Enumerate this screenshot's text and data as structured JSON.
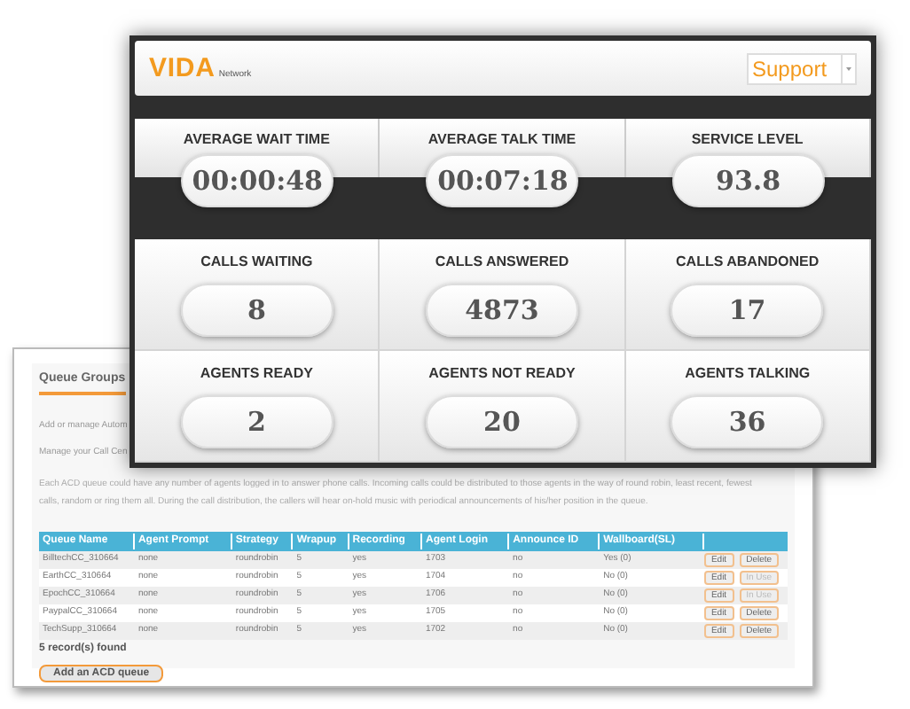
{
  "queue_page": {
    "tab": "Queue Groups",
    "lines": [
      "Add or manage Autom",
      "Manage your Call Cen"
    ],
    "description": [
      "Each ACD queue could have any number of agents logged in to answer phone calls. Incoming calls could be distributed to those agents in the way of round robin, least recent, fewest",
      "calls, random or ring them all. During the call distribution, the callers will hear on-hold music with periodical announcements of his/her position in the queue."
    ],
    "table": {
      "columns": [
        "Queue Name",
        "Agent Prompt",
        "Strategy",
        "Wrapup",
        "Recording",
        "Agent Login",
        "Announce ID",
        "Wallboard(SL)"
      ],
      "rows": [
        {
          "cells": [
            "BilltechCC_310664",
            "none",
            "roundrobin",
            "5",
            "yes",
            "1703",
            "no",
            "Yes (0)"
          ],
          "actions": [
            {
              "label": "Edit",
              "disabled": false
            },
            {
              "label": "Delete",
              "disabled": false
            }
          ]
        },
        {
          "cells": [
            "EarthCC_310664",
            "none",
            "roundrobin",
            "5",
            "yes",
            "1704",
            "no",
            "No (0)"
          ],
          "actions": [
            {
              "label": "Edit",
              "disabled": false
            },
            {
              "label": "In Use",
              "disabled": true
            }
          ]
        },
        {
          "cells": [
            "EpochCC_310664",
            "none",
            "roundrobin",
            "5",
            "yes",
            "1706",
            "no",
            "No (0)"
          ],
          "actions": [
            {
              "label": "Edit",
              "disabled": false
            },
            {
              "label": "In Use",
              "disabled": true
            }
          ]
        },
        {
          "cells": [
            "PaypalCC_310664",
            "none",
            "roundrobin",
            "5",
            "yes",
            "1705",
            "no",
            "No (0)"
          ],
          "actions": [
            {
              "label": "Edit",
              "disabled": false
            },
            {
              "label": "Delete",
              "disabled": false
            }
          ]
        },
        {
          "cells": [
            "TechSupp_310664",
            "none",
            "roundrobin",
            "5",
            "yes",
            "1702",
            "no",
            "No (0)"
          ],
          "actions": [
            {
              "label": "Edit",
              "disabled": false
            },
            {
              "label": "Delete",
              "disabled": false
            }
          ]
        }
      ]
    },
    "record_count": "5 record(s) found",
    "add_button": "Add an ACD queue"
  },
  "dashboard": {
    "logo": "VIDA",
    "logo_sub": "Network",
    "department": {
      "value": "Support"
    },
    "top_metrics": [
      {
        "label": "AVERAGE WAIT TIME",
        "value": "00:00:48"
      },
      {
        "label": "AVERAGE TALK TIME",
        "value": "00:07:18"
      },
      {
        "label": "SERVICE LEVEL",
        "value": "93.8"
      }
    ],
    "grid_metrics": [
      {
        "label": "CALLS WAITING",
        "value": "8"
      },
      {
        "label": "CALLS ANSWERED",
        "value": "4873"
      },
      {
        "label": "CALLS ABANDONED",
        "value": "17"
      },
      {
        "label": "AGENTS READY",
        "value": "2"
      },
      {
        "label": "AGENTS NOT READY",
        "value": "20"
      },
      {
        "label": "AGENTS TALKING",
        "value": "36"
      }
    ]
  }
}
